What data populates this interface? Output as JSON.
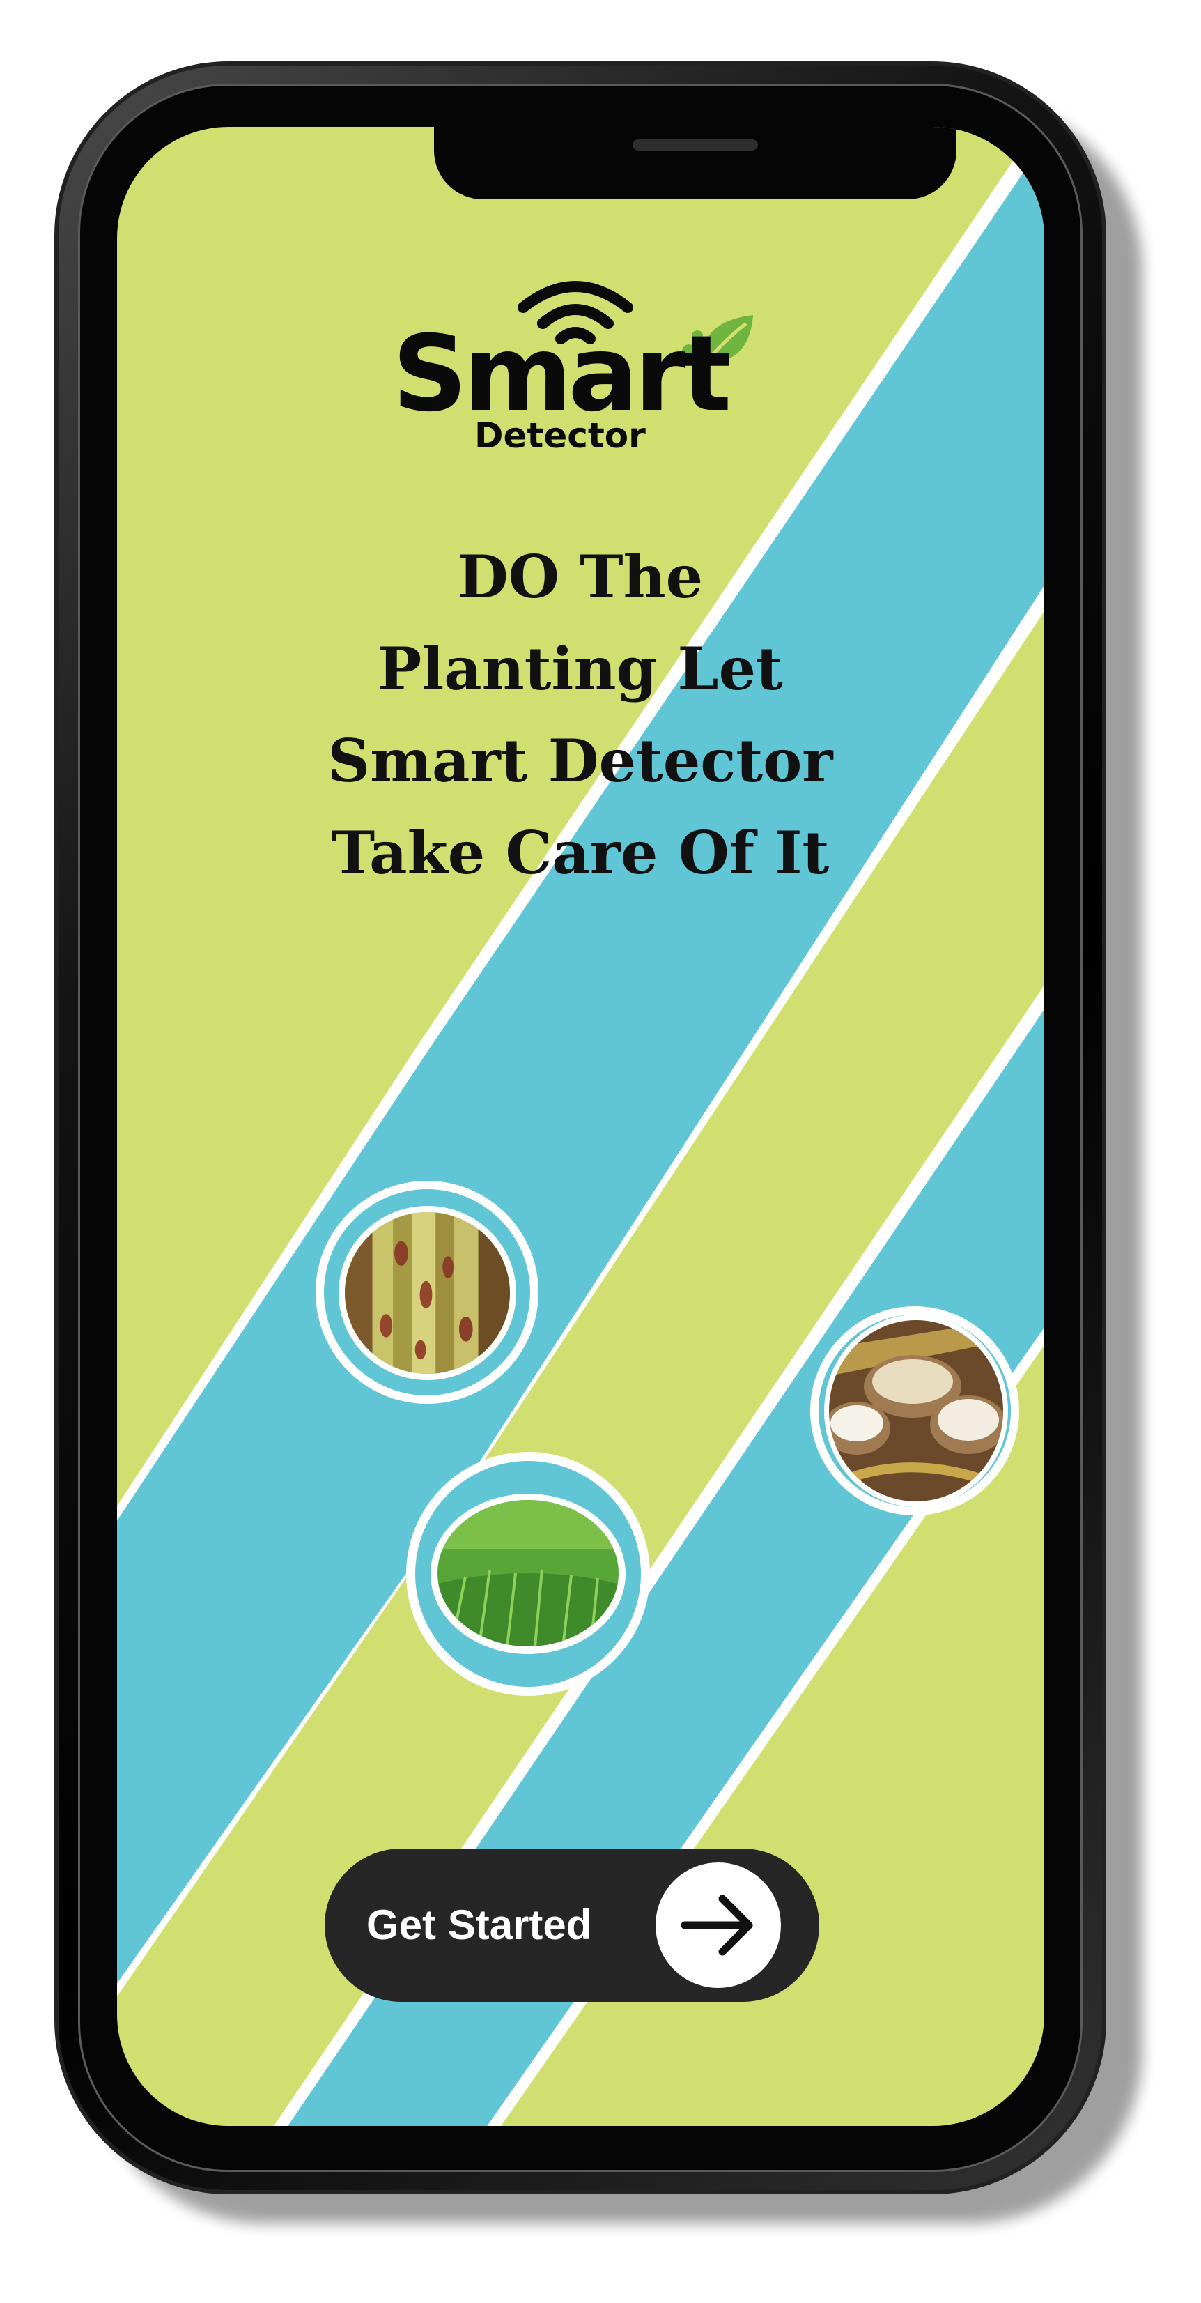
{
  "app": {
    "logo_text": "Smart",
    "logo_subtitle": "Detector",
    "icons": [
      "wifi-icon",
      "leaf-icon",
      "arrow-right-icon"
    ]
  },
  "onboarding": {
    "headline_lines": [
      "DO The",
      "Planting Let",
      "Smart Detector",
      "Take Care Of It"
    ],
    "images": [
      "diseased-rice-leaf-photo",
      "green-rice-field-photo",
      "rice-grain-bowls-photo"
    ],
    "cta_label": "Get Started"
  },
  "colors": {
    "background": "#d0df6f",
    "band": "#60c5d4",
    "band_outline": "#ffffff",
    "button": "#262626",
    "button_text": "#ffffff",
    "leaf": "#6fb43f"
  }
}
